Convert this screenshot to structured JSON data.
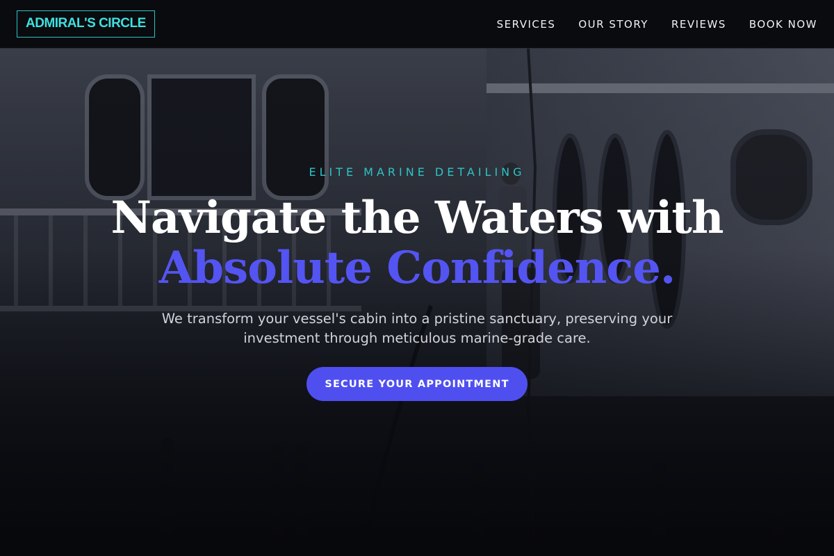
{
  "brand": {
    "logo_text": "ADMIRAL'S CIRCLE"
  },
  "nav": {
    "items": [
      {
        "label": "SERVICES"
      },
      {
        "label": "OUR STORY"
      },
      {
        "label": "REVIEWS"
      },
      {
        "label": "BOOK NOW"
      }
    ]
  },
  "hero": {
    "eyebrow": "ELITE MARINE DETAILING",
    "headline_line1": "Navigate the Waters with",
    "headline_line2": "Absolute Confidence.",
    "subtitle": "We transform your vessel's cabin into a pristine sanctuary, preserving your investment through meticulous marine-grade care.",
    "cta_label": "SECURE YOUR APPOINTMENT",
    "background_image": "yacht-detailing-photo"
  },
  "colors": {
    "accent_teal": "#2ec4c6",
    "accent_indigo": "#5454f2",
    "button": "#4f4ff0",
    "nav_background": "#07080c"
  }
}
